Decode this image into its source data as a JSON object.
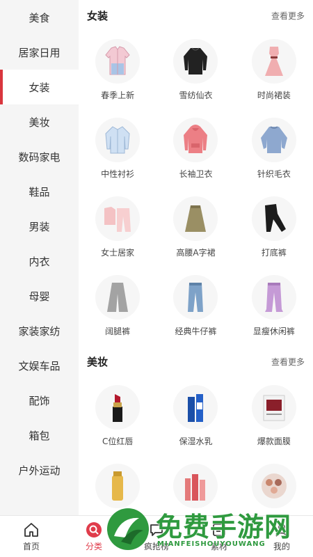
{
  "sidebar": {
    "items": [
      {
        "label": "美食"
      },
      {
        "label": "居家日用"
      },
      {
        "label": "女装"
      },
      {
        "label": "美妆"
      },
      {
        "label": "数码家电"
      },
      {
        "label": "鞋品"
      },
      {
        "label": "男装"
      },
      {
        "label": "内衣"
      },
      {
        "label": "母婴"
      },
      {
        "label": "家装家纺"
      },
      {
        "label": "文娱车品"
      },
      {
        "label": "配饰"
      },
      {
        "label": "箱包"
      },
      {
        "label": "户外运动"
      }
    ],
    "active_index": 2
  },
  "sections": [
    {
      "title": "女装",
      "more": "查看更多",
      "items": [
        {
          "label": "春季上新",
          "icon": "pink-jacket-icon"
        },
        {
          "label": "雪纺仙衣",
          "icon": "black-blouse-icon"
        },
        {
          "label": "时尚裙装",
          "icon": "pink-dress-icon"
        },
        {
          "label": "中性衬衫",
          "icon": "blue-shirt-icon"
        },
        {
          "label": "长袖卫衣",
          "icon": "red-hoodie-icon"
        },
        {
          "label": "针织毛衣",
          "icon": "blue-sweater-icon"
        },
        {
          "label": "女士居家",
          "icon": "pink-pajamas-icon"
        },
        {
          "label": "高腰A字裙",
          "icon": "khaki-skirt-icon"
        },
        {
          "label": "打底裤",
          "icon": "black-leggings-icon"
        },
        {
          "label": "阔腿裤",
          "icon": "gray-wide-pants-icon"
        },
        {
          "label": "经典牛仔裤",
          "icon": "jeans-icon"
        },
        {
          "label": "显瘦休闲裤",
          "icon": "purple-pants-icon"
        }
      ]
    },
    {
      "title": "美妆",
      "more": "查看更多",
      "items": [
        {
          "label": "C位红唇",
          "icon": "lipstick-icon"
        },
        {
          "label": "保湿水乳",
          "icon": "lotion-icon"
        },
        {
          "label": "爆款面膜",
          "icon": "face-mask-icon"
        },
        {
          "label": "",
          "icon": "sunscreen-icon"
        },
        {
          "label": "",
          "icon": "skincare-set-icon"
        },
        {
          "label": "",
          "icon": "eyeshadow-icon"
        }
      ]
    }
  ],
  "bottom_nav": [
    {
      "label": "首页",
      "icon": "home-icon"
    },
    {
      "label": "分类",
      "icon": "search-icon"
    },
    {
      "label": "疯抢榜",
      "icon": "chat-icon"
    },
    {
      "label": "素材",
      "icon": "list-icon"
    },
    {
      "label": "我的",
      "icon": "user-icon"
    }
  ],
  "watermark": {
    "title": "免费手游网",
    "subtitle": "MIANFEISHOUYOUWANG"
  },
  "colors": {
    "accent": "#d9363e",
    "nav_active": "#e03c4b",
    "sidebar_bg": "#f5f5f5",
    "watermark_green": "#2f9a3f"
  }
}
